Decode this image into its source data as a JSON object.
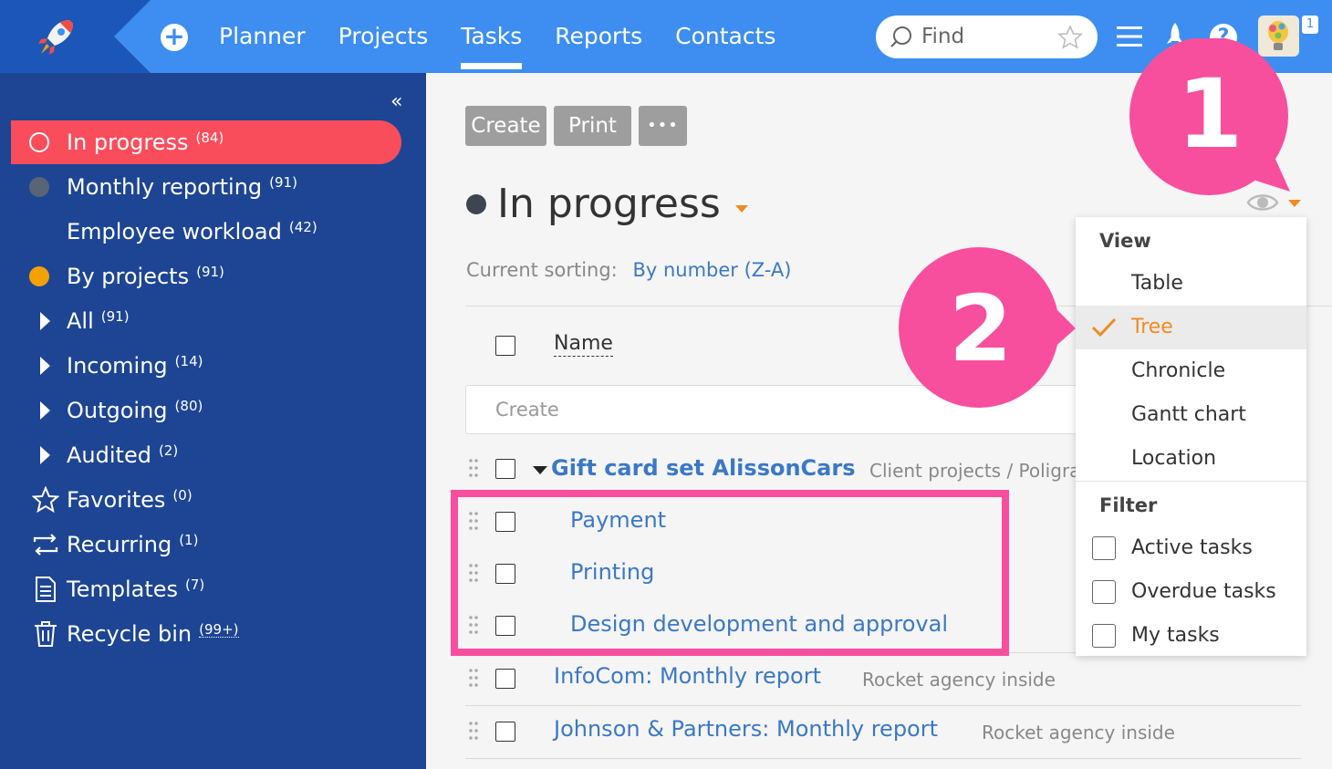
{
  "nav": {
    "items": [
      "Planner",
      "Projects",
      "Tasks",
      "Reports",
      "Contacts"
    ],
    "active": "Tasks",
    "search_placeholder": "Find",
    "notification_count": "1"
  },
  "sidebar": {
    "items": [
      {
        "label": "In progress",
        "count": "(84)",
        "marker": "ring"
      },
      {
        "label": "Monthly reporting",
        "count": "(91)",
        "marker": "grey-dot"
      },
      {
        "label": "Employee workload",
        "count": "(42)",
        "marker": "none"
      },
      {
        "label": "By projects",
        "count": "(91)",
        "marker": "orange-dot"
      },
      {
        "label": "All",
        "count": "(91)",
        "marker": "expand-arrow"
      },
      {
        "label": "Incoming",
        "count": "(14)",
        "marker": "expand-arrow"
      },
      {
        "label": "Outgoing",
        "count": "(80)",
        "marker": "expand-arrow"
      },
      {
        "label": "Audited",
        "count": "(2)",
        "marker": "expand-arrow"
      },
      {
        "label": "Favorites",
        "count": "(0)",
        "marker": "star-icon"
      },
      {
        "label": "Recurring",
        "count": "(1)",
        "marker": "repeat-icon"
      },
      {
        "label": "Templates",
        "count": "(7)",
        "marker": "document-icon"
      },
      {
        "label": "Recycle bin",
        "count": "(99+)",
        "marker": "trash-icon"
      }
    ]
  },
  "toolbar": {
    "create_label": "Create",
    "print_label": "Print",
    "more_label": "•••"
  },
  "main": {
    "title": "In progress",
    "sorting_label": "Current sorting:",
    "sorting_value": "By number (Z-A)",
    "name_header": "Name",
    "create_placeholder": "Create"
  },
  "tasks": [
    {
      "title": "Gift card set AlissonCars",
      "meta": "Client projects / Poligra",
      "parent": true
    },
    {
      "title": "Payment",
      "meta": "",
      "child": true
    },
    {
      "title": "Printing",
      "meta": "",
      "child": true
    },
    {
      "title": "Design development and approval",
      "meta": "",
      "child": true
    },
    {
      "title": "InfoCom: Monthly report",
      "meta": "Rocket agency inside"
    },
    {
      "title": "Johnson & Partners: Monthly report",
      "meta": "Rocket agency inside"
    }
  ],
  "view_menu": {
    "view_heading": "View",
    "views": [
      "Table",
      "Tree",
      "Chronicle",
      "Gantt chart",
      "Location"
    ],
    "selected_view": "Tree",
    "filter_heading": "Filter",
    "filters": [
      "Active tasks",
      "Overdue tasks",
      "My tasks"
    ]
  },
  "callouts": [
    "1",
    "2"
  ],
  "colors": {
    "topbar": "#3d8ef0",
    "sidebar": "#1d4594",
    "active_item": "#fa4d5c",
    "accent_orange": "#f18a1f",
    "link_blue": "#3b78c7",
    "callout_pink": "#f74f9e"
  }
}
